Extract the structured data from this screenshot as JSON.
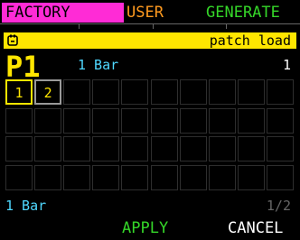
{
  "tabs": {
    "factory": "FACTORY",
    "user": "USER",
    "generate": "GENERATE"
  },
  "banner": {
    "label": "patch load",
    "icon": "patch-icon"
  },
  "patch": {
    "id": "P1",
    "length": "1 Bar",
    "count": "1"
  },
  "grid": {
    "rows": 4,
    "cols": 10,
    "cells": [
      {
        "label": "1",
        "state": "selected"
      },
      {
        "label": "2",
        "state": "filled"
      }
    ]
  },
  "footer": {
    "length": "1 Bar",
    "page": "1/2",
    "apply": "APPLY",
    "cancel": "CANCEL"
  },
  "colors": {
    "factory_tab": "#ff2bd6",
    "user_tab": "#ff9a1f",
    "generate_tab": "#35d629",
    "banner": "#ffe600",
    "accent_cyan": "#4fd8ff"
  }
}
